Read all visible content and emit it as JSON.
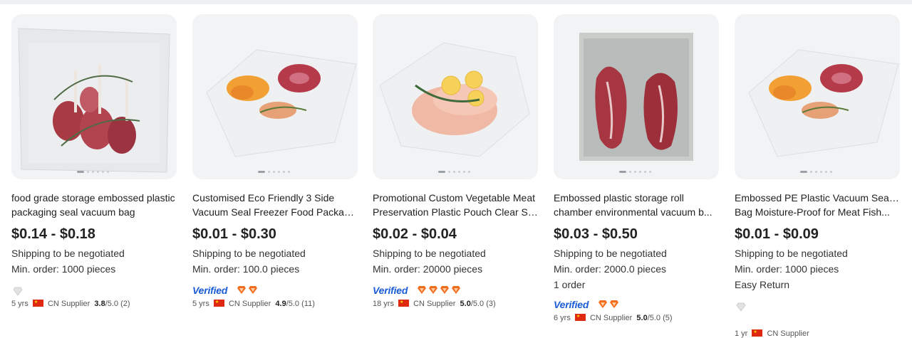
{
  "products": [
    {
      "title_lines": [
        "food grade storage embossed plastic",
        "packaging seal vacuum bag"
      ],
      "price": "$0.14 - $0.18",
      "shipping": "Shipping to be negotiated",
      "min_order": "Min. order: 1000 pieces",
      "extra": "",
      "verified": "",
      "diamonds": 1,
      "years": "5 yrs",
      "supplier": "CN Supplier",
      "rating": "3.8",
      "rating_suffix": "/5.0 (2)"
    },
    {
      "title_lines": [
        "Customised Eco Friendly 3 Side",
        "Vacuum Seal Freezer Food Packagi..."
      ],
      "price": "$0.01 - $0.30",
      "shipping": "Shipping to be negotiated",
      "min_order": "Min. order: 100.0 pieces",
      "extra": "",
      "verified": "Verified",
      "diamonds": 2,
      "years": "5 yrs",
      "supplier": "CN Supplier",
      "rating": "4.9",
      "rating_suffix": "/5.0 (11)"
    },
    {
      "title_lines": [
        "Promotional Custom Vegetable Meat",
        "Preservation Plastic Pouch Clear Se..."
      ],
      "price": "$0.02 - $0.04",
      "shipping": "Shipping to be negotiated",
      "min_order": "Min. order: 20000 pieces",
      "extra": "",
      "verified": "Verified",
      "diamonds": 4,
      "years": "18 yrs",
      "supplier": "CN Supplier",
      "rating": "5.0",
      "rating_suffix": "/5.0 (3)"
    },
    {
      "title_lines": [
        "Embossed plastic storage roll",
        "chamber environmental vacuum b..."
      ],
      "price": "$0.03 - $0.50",
      "shipping": "Shipping to be negotiated",
      "min_order": "Min. order: 2000.0 pieces",
      "extra": "1 order",
      "verified": "Verified",
      "diamonds": 2,
      "years": "6 yrs",
      "supplier": "CN Supplier",
      "rating": "5.0",
      "rating_suffix": "/5.0 (5)"
    },
    {
      "title_lines": [
        "Embossed PE Plastic Vacuum Sealer",
        "Bag Moisture-Proof for Meat Fish..."
      ],
      "price": "$0.01 - $0.09",
      "shipping": "Shipping to be negotiated",
      "min_order": "Min. order: 1000 pieces",
      "extra": "Easy Return",
      "verified": "",
      "diamonds": 1,
      "years": "1 yr",
      "supplier": "CN Supplier",
      "rating": "",
      "rating_suffix": ""
    }
  ],
  "colors": {
    "verified": "#1a5cd6",
    "diamond": "#f36b1c",
    "diamond_empty": "#d8d8d8",
    "flag": "#de2910"
  },
  "icons": {
    "diamond": "diamond-icon",
    "flag": "cn-flag-icon"
  }
}
